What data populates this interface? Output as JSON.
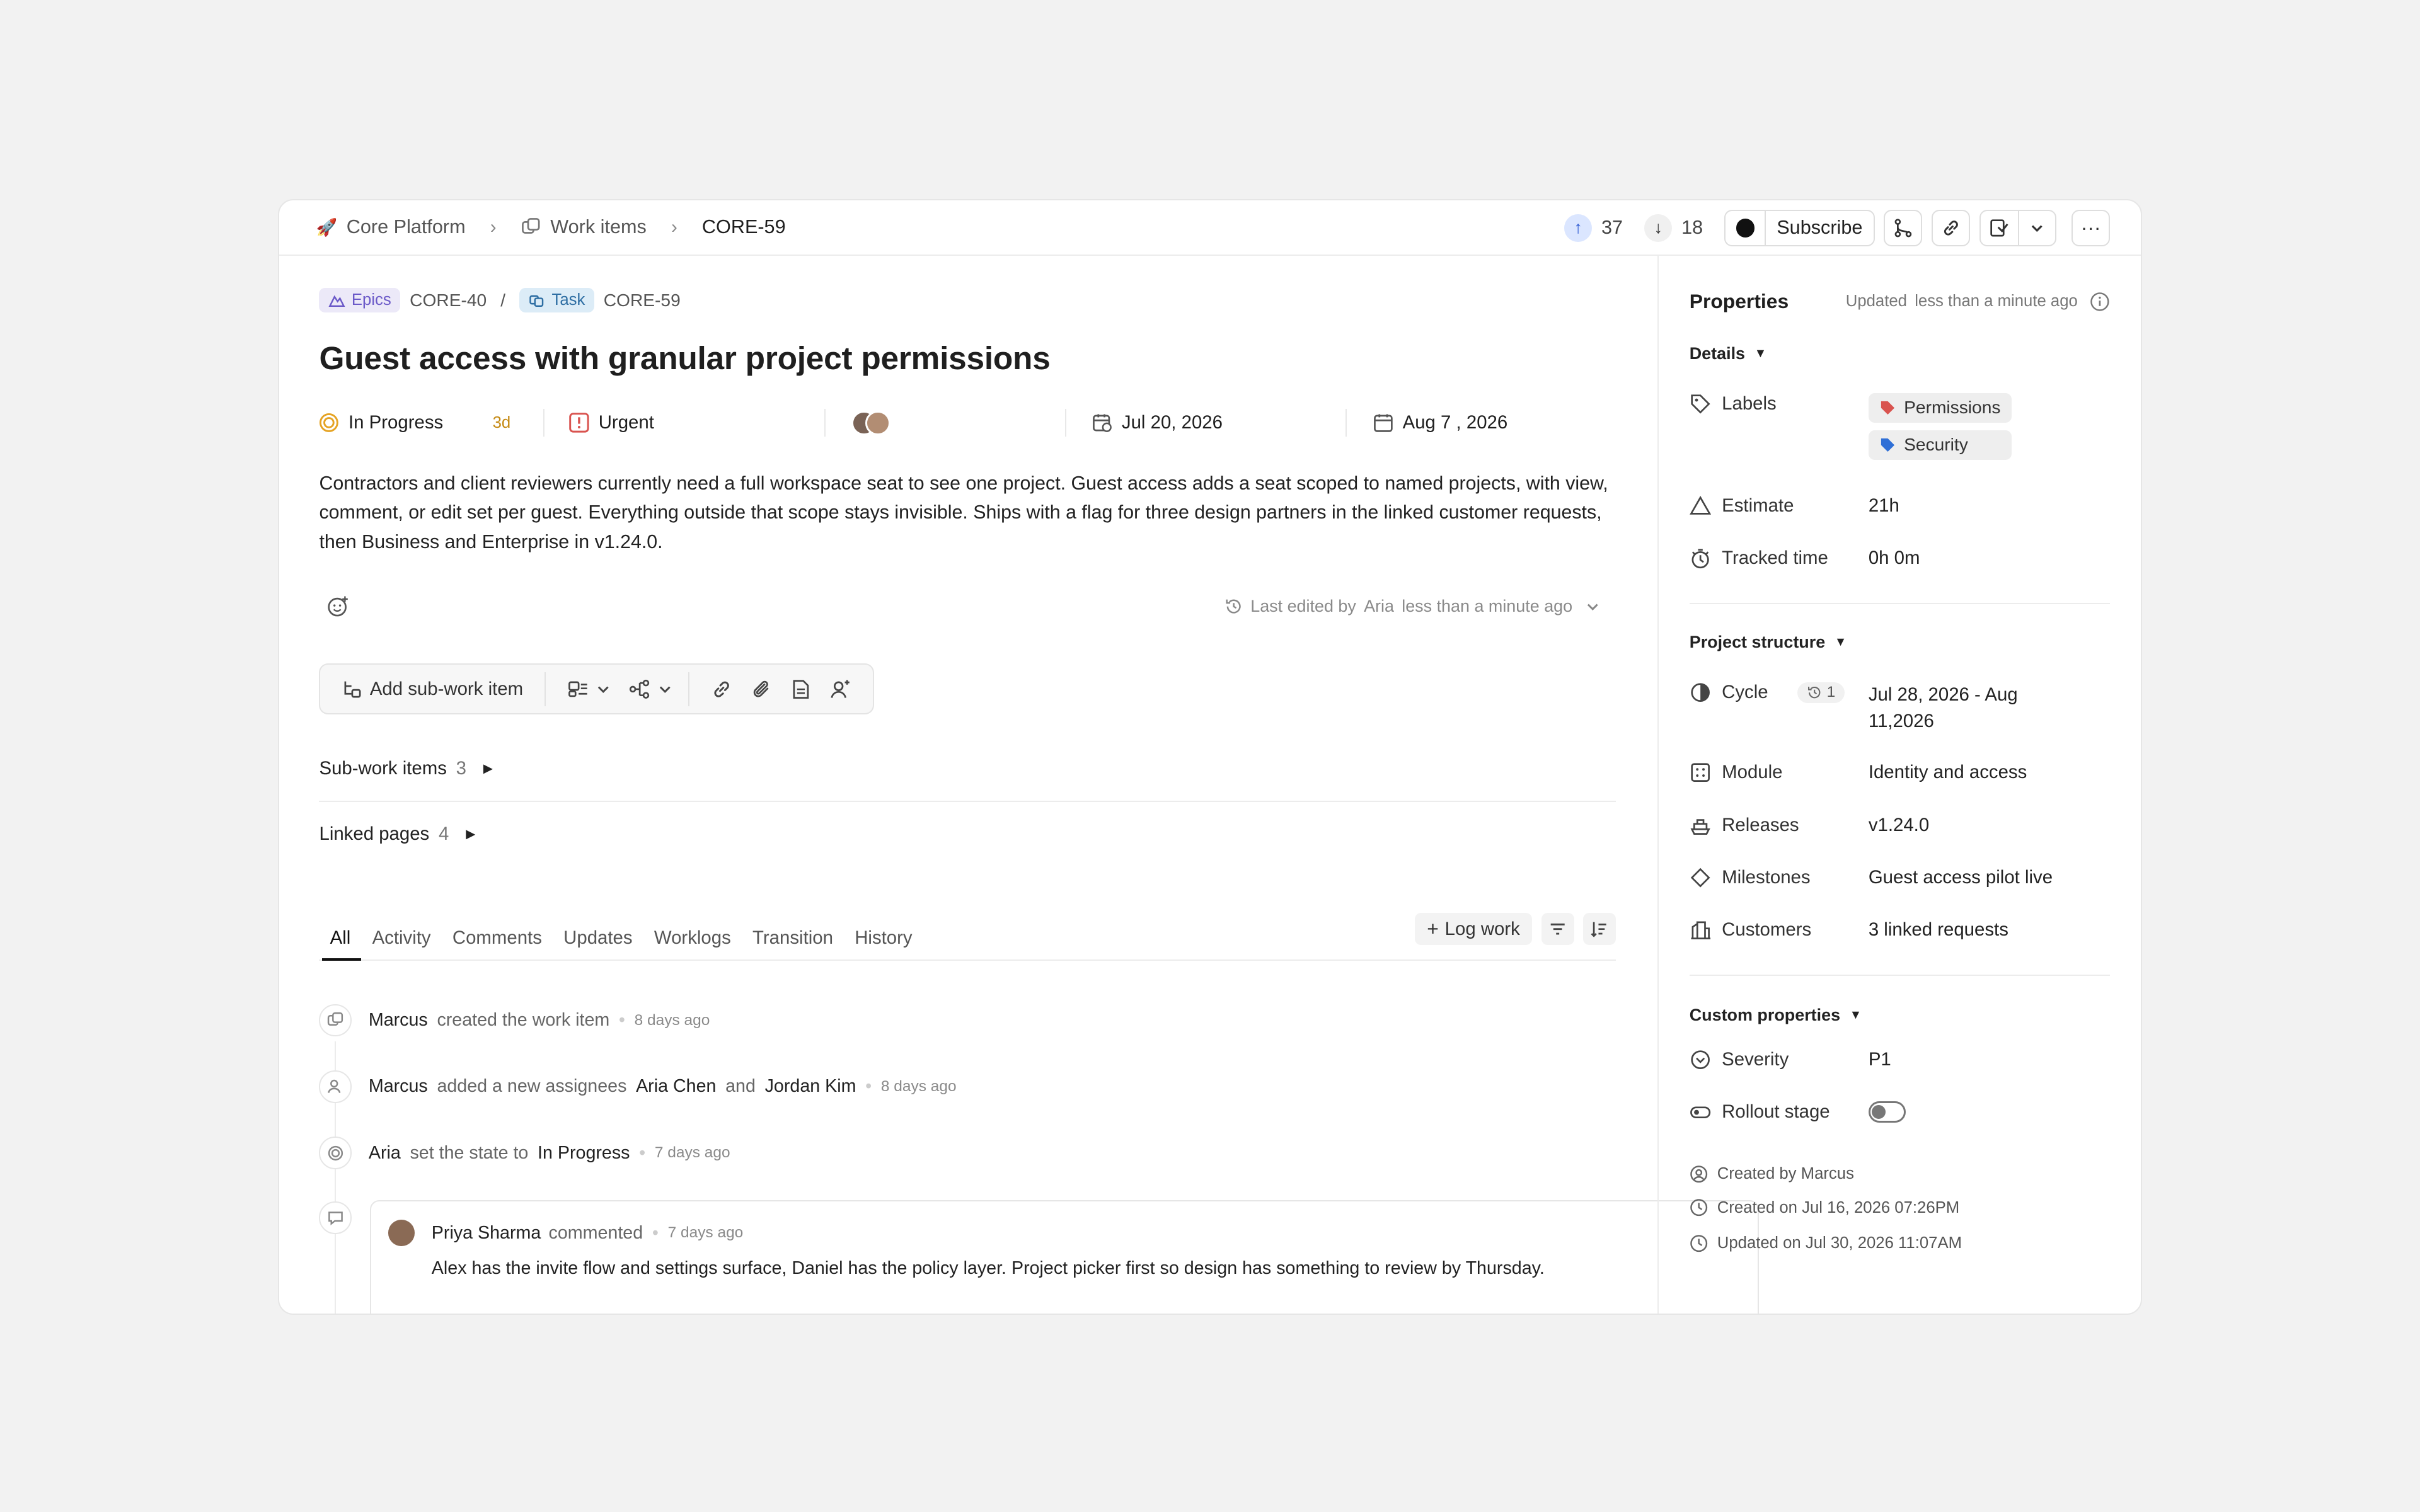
{
  "breadcrumb": {
    "project": "Core Platform",
    "section": "Work items",
    "current": "CORE-59",
    "project_icon": "rocket-icon"
  },
  "votes": {
    "up": "37",
    "down": "18"
  },
  "toolbar_top": {
    "subscribe_label": "Subscribe"
  },
  "parent_chain": {
    "epic_chip": "Epics",
    "epic_id": "CORE-40",
    "separator": "/",
    "task_chip": "Task",
    "task_id": "CORE-59"
  },
  "title": "Guest access with granular project permissions",
  "quick_props": {
    "state": "In Progress",
    "state_age": "3d",
    "priority": "Urgent",
    "start_date": "Jul 20, 2026",
    "due_date": "Aug 7 , 2026"
  },
  "description": "Contractors and client reviewers currently need a full workspace seat to see one project. Guest access adds a seat scoped to named projects, with view, comment, or edit set per guest. Everything outside that scope stays invisible. Ships with a flag for three design partners in the linked customer requests, then Business and Enterprise in v1.24.0.",
  "last_edited": {
    "prefix": "Last edited by",
    "user": "Aria",
    "time": "less than a minute ago"
  },
  "action_bar": {
    "add_sub": "Add sub-work item"
  },
  "sub_items": {
    "label": "Sub-work items",
    "count": "3"
  },
  "linked_pages": {
    "label": "Linked pages",
    "count": "4"
  },
  "tabs": [
    "All",
    "Activity",
    "Comments",
    "Updates",
    "Worklogs",
    "Transition",
    "History"
  ],
  "log_work": "Log work",
  "activity": [
    {
      "who": "Marcus",
      "text": "created the work item",
      "time": "8 days ago"
    },
    {
      "who": "Marcus",
      "text": "added a new assignees",
      "a1": "Aria Chen",
      "and": "and",
      "a2": "Jordan Kim",
      "time": "8 days ago"
    },
    {
      "who": "Aria",
      "text": "set the state to",
      "state": "In Progress",
      "time": "7 days ago"
    }
  ],
  "comment": {
    "who": "Priya Sharma",
    "verb": "commented",
    "time": "7 days ago",
    "body": "Alex has the invite flow and settings surface, Daniel has the policy layer. Project picker first so design has something to review by Thursday."
  },
  "properties": {
    "title": "Properties",
    "updated_prefix": "Updated",
    "updated_time": "less than a minute ago",
    "details_label": "Details",
    "labels_key": "Labels",
    "labels": [
      {
        "name": "Permissions",
        "color": "#d9534f"
      },
      {
        "name": "Security",
        "color": "#2f6fd6"
      }
    ],
    "estimate_key": "Estimate",
    "estimate": "21h",
    "tracked_key": "Tracked time",
    "tracked": "0h 0m",
    "structure_label": "Project structure",
    "cycle_key": "Cycle",
    "cycle_badge": "1",
    "cycle_line1": "Jul 28, 2026 - Aug",
    "cycle_line2": "11,2026",
    "module_key": "Module",
    "module": "Identity and access",
    "releases_key": "Releases",
    "releases": "v1.24.0",
    "milestones_key": "Milestones",
    "milestones": "Guest access pilot live",
    "customers_key": "Customers",
    "customers": "3 linked requests",
    "custom_label": "Custom properties",
    "severity_key": "Severity",
    "severity": "P1",
    "rollout_key": "Rollout stage",
    "rollout_on": false,
    "created_by": "Created by Marcus",
    "created_on": "Created on Jul 16, 2026 07:26PM",
    "updated_on": "Updated on Jul 30, 2026 11:07AM"
  }
}
